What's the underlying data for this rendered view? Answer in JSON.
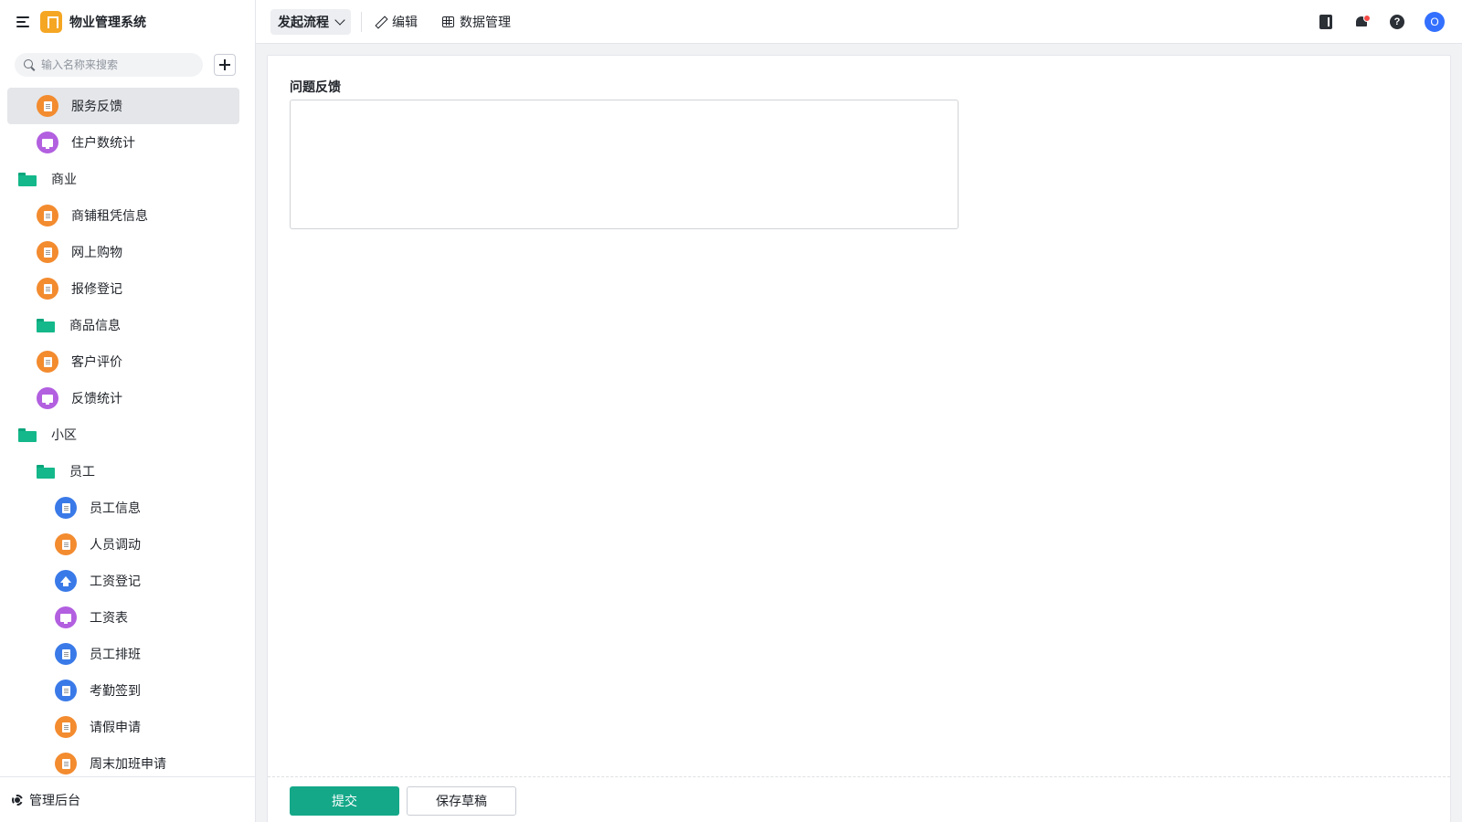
{
  "app": {
    "title": "物业管理系统"
  },
  "search": {
    "placeholder": "输入名称来搜索"
  },
  "sidebar": {
    "items": [
      {
        "label": "服务反馈",
        "type": "form",
        "color": "orange",
        "indent": 1,
        "active": true
      },
      {
        "label": "住户数统计",
        "type": "report",
        "color": "purple",
        "indent": 1
      },
      {
        "label": "商业",
        "type": "folder",
        "indent": 0
      },
      {
        "label": "商铺租凭信息",
        "type": "doc",
        "color": "orange",
        "indent": 1
      },
      {
        "label": "网上购物",
        "type": "doc",
        "color": "orange",
        "indent": 1
      },
      {
        "label": "报修登记",
        "type": "form",
        "color": "orange",
        "indent": 1
      },
      {
        "label": "商品信息",
        "type": "folder",
        "indent": 1
      },
      {
        "label": "客户评价",
        "type": "doc",
        "color": "orange",
        "indent": 1
      },
      {
        "label": "反馈统计",
        "type": "report",
        "color": "purple",
        "indent": 1
      },
      {
        "label": "小区",
        "type": "folder",
        "indent": 0
      },
      {
        "label": "员工",
        "type": "folder",
        "indent": 1
      },
      {
        "label": "员工信息",
        "type": "doc",
        "color": "blue",
        "indent": 2
      },
      {
        "label": "人员调动",
        "type": "form",
        "color": "orange",
        "indent": 2
      },
      {
        "label": "工资登记",
        "type": "upload",
        "color": "blue",
        "indent": 2
      },
      {
        "label": "工资表",
        "type": "report",
        "color": "purple",
        "indent": 2
      },
      {
        "label": "员工排班",
        "type": "doc",
        "color": "blue",
        "indent": 2
      },
      {
        "label": "考勤签到",
        "type": "doc",
        "color": "blue",
        "indent": 2
      },
      {
        "label": "请假申请",
        "type": "form",
        "color": "orange",
        "indent": 2
      },
      {
        "label": "周末加班申请",
        "type": "form",
        "color": "orange",
        "indent": 2
      }
    ],
    "admin_label": "管理后台"
  },
  "toolbar": {
    "flow_label": "发起流程",
    "edit_label": "编辑",
    "data_label": "数据管理",
    "help_glyph": "?",
    "avatar_initial": "O"
  },
  "form": {
    "field_label": "问题反馈",
    "field_value": "",
    "submit_label": "提交",
    "draft_label": "保存草稿"
  },
  "colors": {
    "accent": "#14a889",
    "orange": "#f38b2f",
    "purple": "#b25fe0",
    "blue": "#3a7ae8",
    "folder": "#14b88a"
  }
}
